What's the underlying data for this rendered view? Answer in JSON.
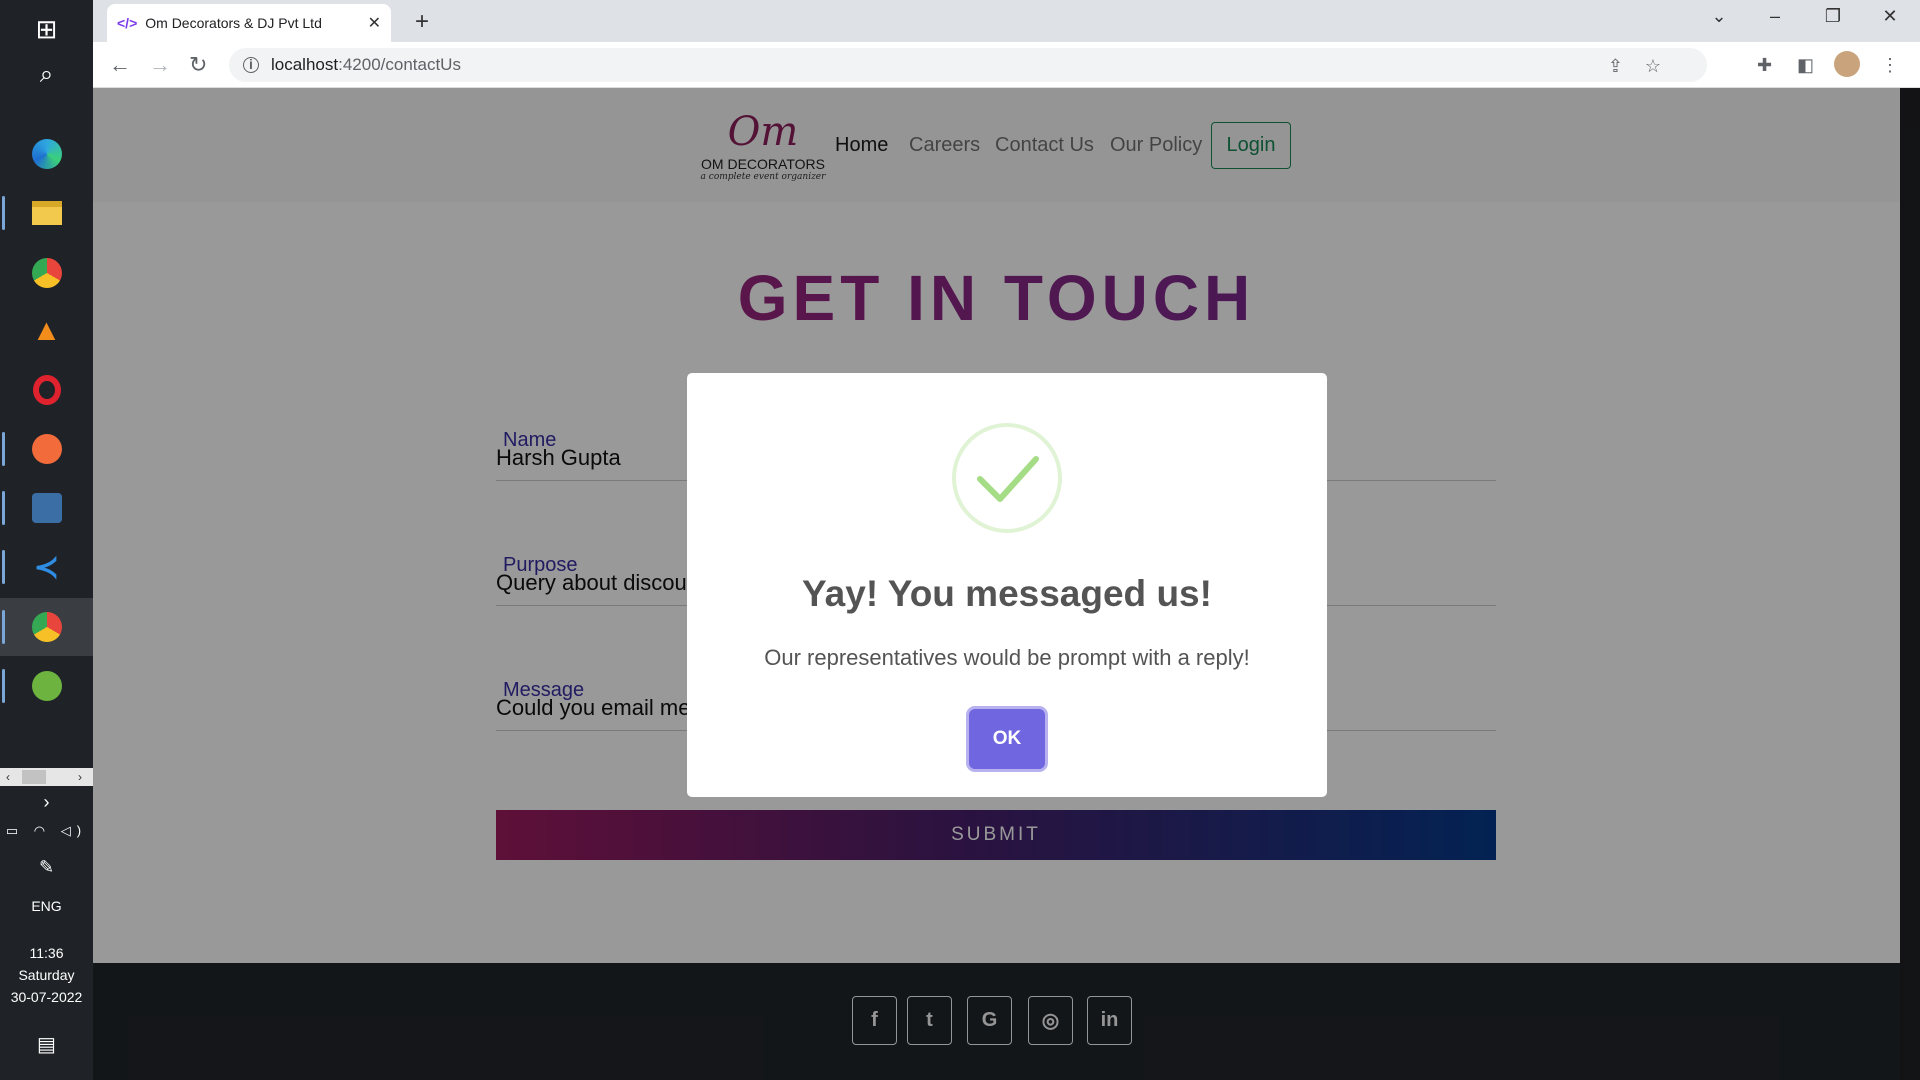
{
  "taskbar": {
    "apps": [
      {
        "name": "windows-start",
        "glyph": "⊞",
        "color": "#ffffff"
      },
      {
        "name": "search",
        "glyph": "⌕",
        "color": "#ffffff"
      },
      {
        "name": "edge",
        "glyph": "◉",
        "color": "#2fa7e0"
      },
      {
        "name": "file-explorer",
        "glyph": "▬",
        "color": "#f2c94c"
      },
      {
        "name": "chrome",
        "glyph": "◎",
        "color": "#e8453c"
      },
      {
        "name": "vlc",
        "glyph": "▲",
        "color": "#f28c1b"
      },
      {
        "name": "opera",
        "glyph": "O",
        "color": "#e0222e"
      },
      {
        "name": "postman",
        "glyph": "●",
        "color": "#f26b3a"
      },
      {
        "name": "mysql-workbench",
        "glyph": "◆",
        "color": "#3a6ea5"
      },
      {
        "name": "vscode",
        "glyph": "◀",
        "color": "#2f8de4"
      },
      {
        "name": "chrome-profile",
        "glyph": "◎",
        "color": "#e8453c"
      },
      {
        "name": "spring-tool",
        "glyph": "●",
        "color": "#6db33f"
      }
    ],
    "language": "ENG",
    "time": "11:36",
    "day": "Saturday",
    "date": "30-07-2022"
  },
  "browser": {
    "tab_title": "Om Decorators & DJ Pvt Ltd",
    "url_host": "localhost",
    "url_rest": ":4200/contactUs"
  },
  "site": {
    "logo_name": "OM DECORATORS",
    "logo_tagline": "a complete event organizer",
    "logo_mark": "Om",
    "nav": [
      "Home",
      "Careers",
      "Contact Us",
      "Our Policy"
    ],
    "login_label": "Login",
    "heading": "GET IN TOUCH",
    "form": {
      "name_label": "Name",
      "name_value": "Harsh Gupta",
      "purpose_label": "Purpose",
      "purpose_value": "Query about discou",
      "message_label": "Message",
      "message_value": "Could you email me"
    },
    "submit_label": "SUBMIT",
    "social": [
      "f",
      "t",
      "G",
      "◎",
      "in"
    ]
  },
  "modal": {
    "title": "Yay! You messaged us!",
    "text": "Our representatives would be prompt with a reply!",
    "ok_label": "OK",
    "accent": "#7066e0",
    "success_color": "#a5dc86"
  }
}
